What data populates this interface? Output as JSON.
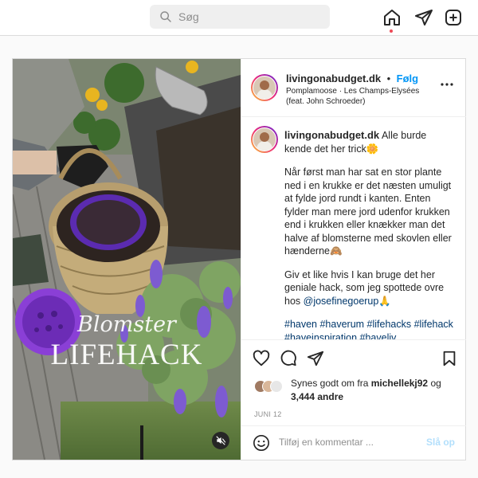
{
  "search": {
    "placeholder": "Søg"
  },
  "post": {
    "author": "livingonabudget.dk",
    "dot": "•",
    "follow_label": "Følg",
    "audio_line1": "Pomplamoose · Les Champs-Elysées",
    "audio_line2": "(feat. John Schroeder)",
    "overlay_script": "Blomster",
    "overlay_title": "LIFEHACK",
    "caption": {
      "p1": "Alle burde kende det her trick🌼",
      "p2": "Når først man har sat en stor plante ned i en krukke er det næsten umuligt at fylde jord rundt i kanten. Enten fylder man mere jord udenfor krukken end i krukken eller knækker man det halve af blomsterne med skovlen eller hænderne🙈",
      "p3_pre": "Giv et like hvis I kan bruge det her geniale hack, som jeg spottede ovre hos ",
      "p3_mention": "@josefinegoerup",
      "p3_post": "🙏",
      "hashtags": "#haven #haverum #lifehacks #lifehack #haveinspiration #haveliv #haveplaner #haveideer #lifestyle #interior"
    },
    "likes": {
      "prefix": "Synes godt om fra ",
      "user": "michellekj92",
      "middle": " og",
      "count": "3,444 andre"
    },
    "date": "JUNI 12",
    "comment": {
      "placeholder": "Tilføj en kommentar ...",
      "post_label": "Slå op"
    }
  },
  "icons": {
    "nav": [
      "home-icon",
      "direct-icon",
      "new-post-icon"
    ],
    "actions": [
      "heart-icon",
      "comment-icon",
      "share-icon",
      "bookmark-icon"
    ],
    "other": [
      "search-icon",
      "more-icon",
      "mute-icon",
      "emoji-icon"
    ]
  },
  "colors": {
    "link": "#0095f6",
    "hashtag": "#00376b",
    "notification": "#ed4956",
    "post_disabled": "#b2dffc"
  }
}
